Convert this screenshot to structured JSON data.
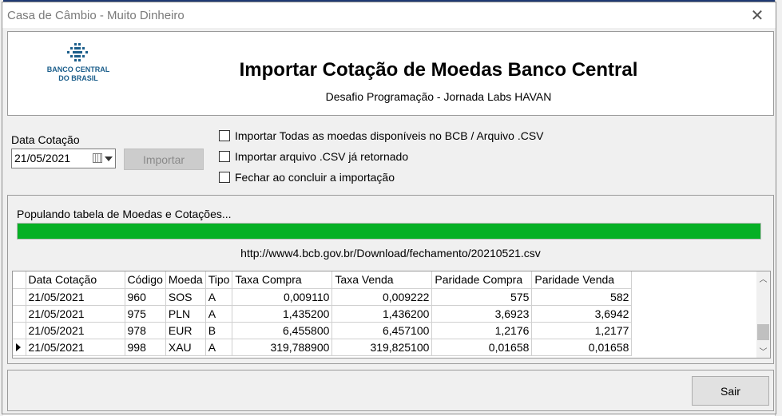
{
  "window": {
    "title": "Casa de Câmbio - Muito Dinheiro",
    "close_glyph": "✕"
  },
  "header": {
    "logo": {
      "icon": "bcb-logo-icon",
      "text": "BANCO CENTRAL\nDO BRASIL"
    },
    "title": "Importar Cotação de Moedas Banco Central",
    "subtitle": "Desafio Programação - Jornada Labs HAVAN"
  },
  "controls": {
    "date_label": "Data Cotação",
    "date_value": "21/05/2021",
    "import_label": "Importar",
    "checkboxes": [
      {
        "label": "Importar Todas as moedas disponíveis no BCB / Arquivo .CSV",
        "checked": false
      },
      {
        "label": "Importar arquivo .CSV já retornado",
        "checked": false
      },
      {
        "label": "Fechar ao concluir a importação",
        "checked": false
      }
    ]
  },
  "progress": {
    "status": "Populando tabela de Moedas e Cotações...",
    "value_percent": 100,
    "color": "#06b025",
    "url": "http://www4.bcb.gov.br/Download/fechamento/20210521.csv"
  },
  "table": {
    "columns": [
      "Data Cotação",
      "Código",
      "Moeda",
      "Tipo",
      "Taxa Compra",
      "Taxa Venda",
      "Paridade Compra",
      "Paridade Venda"
    ],
    "rows": [
      [
        "21/05/2021",
        "960",
        "SOS",
        "A",
        "0,009110",
        "0,009222",
        "575",
        "582"
      ],
      [
        "21/05/2021",
        "975",
        "PLN",
        "A",
        "1,435200",
        "1,436200",
        "3,6923",
        "3,6942"
      ],
      [
        "21/05/2021",
        "978",
        "EUR",
        "B",
        "6,455800",
        "6,457100",
        "1,2176",
        "1,2177"
      ],
      [
        "21/05/2021",
        "998",
        "XAU",
        "A",
        "319,788900",
        "319,825100",
        "0,01658",
        "0,01658"
      ]
    ],
    "current_row_index": 3
  },
  "footer": {
    "exit_label": "Sair"
  }
}
